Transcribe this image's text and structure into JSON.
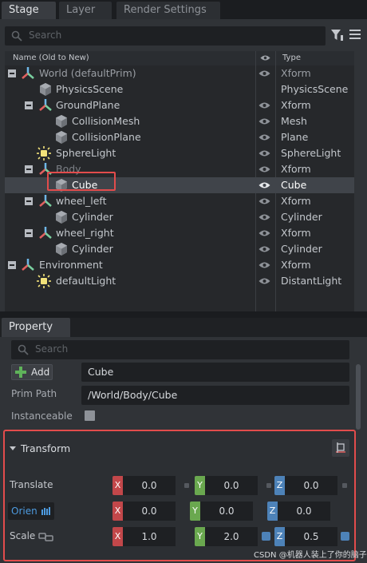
{
  "tabs": [
    {
      "label": "Stage",
      "active": true
    },
    {
      "label": "Layer",
      "active": false
    },
    {
      "label": "Render Settings",
      "active": false
    }
  ],
  "stage": {
    "search_placeholder": "Search",
    "columns": {
      "name": "Name (Old to New)",
      "type": "Type"
    },
    "rows": [
      {
        "label": "World (defaultPrim)",
        "type": "Xform",
        "icon": "xform-icon",
        "expanded": true,
        "eye": true
      },
      {
        "label": "PhysicsScene",
        "type": "PhysicsScene",
        "icon": "cube-icon",
        "eye": false
      },
      {
        "label": "GroundPlane",
        "type": "Xform",
        "icon": "xform-icon",
        "expanded": true,
        "eye": true
      },
      {
        "label": "CollisionMesh",
        "type": "Mesh",
        "icon": "cube-icon",
        "eye": true
      },
      {
        "label": "CollisionPlane",
        "type": "Plane",
        "icon": "cube-icon",
        "eye": true
      },
      {
        "label": "SphereLight",
        "type": "SphereLight",
        "icon": "light-icon",
        "eye": true
      },
      {
        "label": "Body",
        "type": "Xform",
        "icon": "xform-icon",
        "expanded": true,
        "eye": true
      },
      {
        "label": "Cube",
        "type": "Cube",
        "icon": "cube-icon",
        "eye": true,
        "selected": true
      },
      {
        "label": "wheel_left",
        "type": "Xform",
        "icon": "xform-icon",
        "expanded": true,
        "eye": true
      },
      {
        "label": "Cylinder",
        "type": "Cylinder",
        "icon": "cube-icon",
        "eye": true
      },
      {
        "label": "wheel_right",
        "type": "Xform",
        "icon": "xform-icon",
        "expanded": true,
        "eye": true
      },
      {
        "label": "Cylinder",
        "type": "Cylinder",
        "icon": "cube-icon",
        "eye": true
      },
      {
        "label": "Environment",
        "type": "Xform",
        "icon": "xform-icon",
        "expanded": true,
        "eye": true
      },
      {
        "label": "defaultLight",
        "type": "DistantLight",
        "icon": "light-icon",
        "eye": true
      }
    ]
  },
  "property": {
    "tab_label": "Property",
    "search_placeholder": "Search",
    "add_label": "Add",
    "prim_name": "Cube",
    "prim_path_label": "Prim Path",
    "prim_path": "/World/Body/Cube",
    "instanceable_label": "Instanceable",
    "transform": {
      "title": "Transform",
      "translate_label": "Translate",
      "orient_label": "Orien",
      "scale_label": "Scale",
      "axis_x": "X",
      "axis_y": "Y",
      "axis_z": "Z",
      "translate": [
        "0.0",
        "0.0",
        "0.0"
      ],
      "orient": [
        "0.0",
        "0.0",
        "0.0"
      ],
      "scale": [
        "1.0",
        "2.0",
        "0.5"
      ]
    }
  },
  "watermark": "CSDN @机器人装上了你的脑子",
  "colors": {
    "highlight": "#e24c4c",
    "axis_x": "#c2474a",
    "axis_y": "#6aa84f",
    "axis_z": "#4d82b8"
  }
}
